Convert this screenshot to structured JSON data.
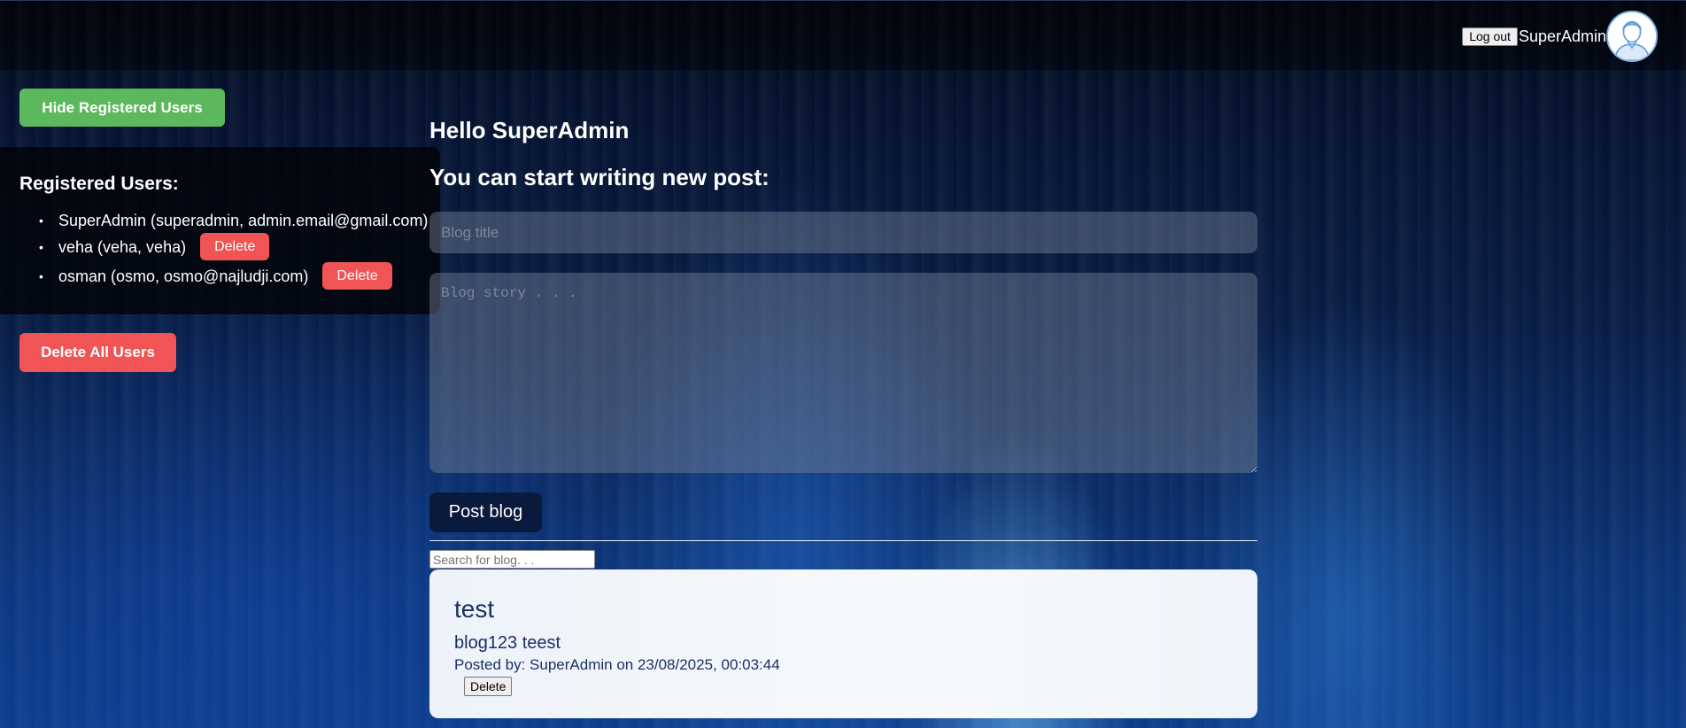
{
  "header": {
    "logout_label": "Log out",
    "username": "SuperAdmin",
    "avatar_icon": "user-avatar-icon"
  },
  "sidebar": {
    "toggle_users_label": "Hide Registered Users",
    "users_heading": "Registered Users:",
    "users": [
      {
        "text": "SuperAdmin (superadmin, admin.email@gmail.com)",
        "deletable": false
      },
      {
        "text": "veha (veha, veha)",
        "deletable": true,
        "delete_label": "Delete"
      },
      {
        "text": "osman (osmo, osmo@najludji.com)",
        "deletable": true,
        "delete_label": "Delete"
      }
    ],
    "delete_all_label": "Delete All Users"
  },
  "main": {
    "greeting": "Hello SuperAdmin",
    "prompt": "You can start writing new post:",
    "title_placeholder": "Blog title",
    "title_value": "",
    "story_placeholder": "Blog story . . .",
    "story_value": "",
    "post_label": "Post blog",
    "search_placeholder": "Search for blog. . .",
    "search_value": ""
  },
  "blogs": [
    {
      "title": "test",
      "body": "blog123 teest",
      "meta": "Posted by: SuperAdmin on 23/08/2025, 00:03:44",
      "delete_label": "Delete"
    }
  ],
  "colors": {
    "green_button": "#5cb85c",
    "red_button": "#f05454",
    "post_button": "#0a1a3d",
    "card_text": "#1b2f66"
  }
}
